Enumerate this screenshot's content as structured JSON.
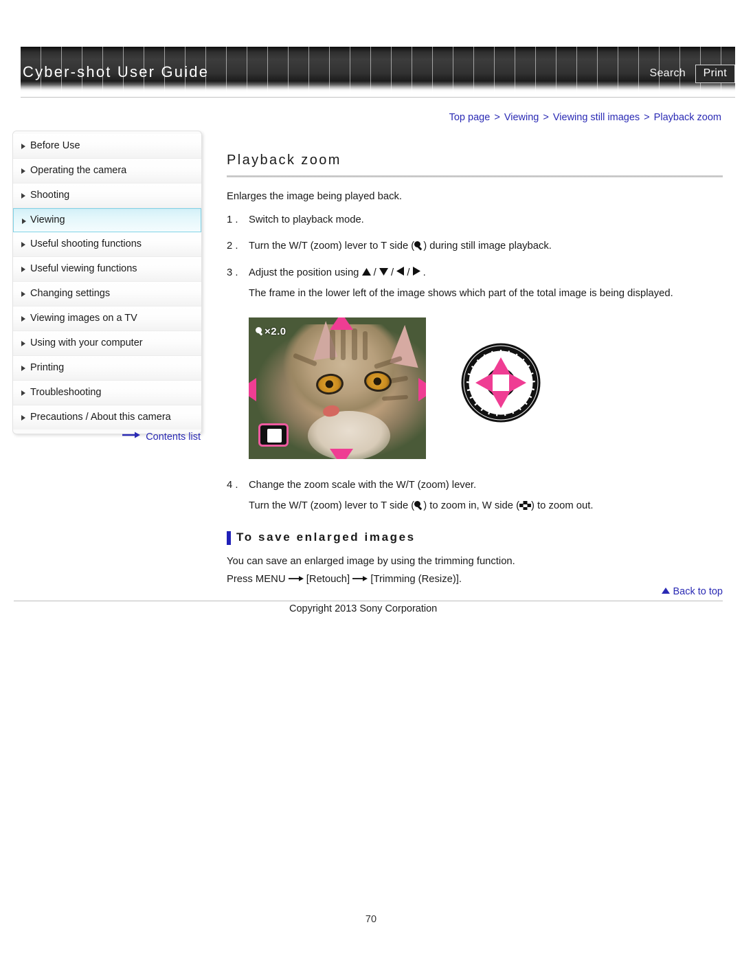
{
  "header": {
    "title": "Cyber-shot User Guide",
    "search_label": "Search",
    "print_label": "Print"
  },
  "breadcrumb": {
    "separator": ">",
    "items": [
      "Top page",
      "Viewing",
      "Viewing still images",
      "Playback zoom"
    ]
  },
  "sidebar": {
    "items": [
      {
        "label": "Before Use",
        "active": false
      },
      {
        "label": "Operating the camera",
        "active": false
      },
      {
        "label": "Shooting",
        "active": false
      },
      {
        "label": "Viewing",
        "active": true
      },
      {
        "label": "Useful shooting functions",
        "active": false
      },
      {
        "label": "Useful viewing functions",
        "active": false
      },
      {
        "label": "Changing settings",
        "active": false
      },
      {
        "label": "Viewing images on a TV",
        "active": false
      },
      {
        "label": "Using with your computer",
        "active": false
      },
      {
        "label": "Printing",
        "active": false
      },
      {
        "label": "Troubleshooting",
        "active": false
      },
      {
        "label": "Precautions / About this camera",
        "active": false
      }
    ],
    "contents_link": "Contents list"
  },
  "main": {
    "title": "Playback zoom",
    "intro": "Enlarges the image being played back.",
    "steps": [
      {
        "num": "1 .",
        "text_before": "Switch to playback mode.",
        "icon": null,
        "text_after": "",
        "sub": ""
      },
      {
        "num": "2 .",
        "text_before": "Turn the W/T (zoom) lever to T side (",
        "icon": "magnifier-icon",
        "text_after": ") during still image playback.",
        "sub": ""
      },
      {
        "num": "3 .",
        "text_before": "Adjust the position using ",
        "icon": "dpad-glyphs",
        "text_after": " .",
        "sub": "The frame in the lower left of the image shows which part of the total image is being displayed."
      },
      {
        "num": "4 .",
        "text_before": "Change the zoom scale with the W/T (zoom) lever.",
        "icon": null,
        "text_after": "",
        "sub": ""
      }
    ],
    "step4_sub_part1": "Turn the W/T (zoom) lever to T side (",
    "step4_sub_part2": ") to zoom in, W side (",
    "step4_sub_part3": ") to zoom out.",
    "figure": {
      "zoom_scale_label": "×2.0",
      "magnifier_icon": "magnifier-icon",
      "arrows": [
        "up-arrow-icon",
        "down-arrow-icon",
        "left-arrow-icon",
        "right-arrow-icon"
      ],
      "position_frame_icon": "position-frame-icon",
      "control_wheel_icon": "control-wheel-icon"
    },
    "subsection": {
      "title": "To save enlarged images",
      "line1": "You can save an enlarged image by using the trimming function.",
      "line2_part1": "Press MENU",
      "line2_part2": "[Retouch]",
      "line2_part3": "[Trimming (Resize)].",
      "arrow_glyph": "→"
    }
  },
  "footer": {
    "back_to_top": "Back to top",
    "copyright": "Copyright 2013 Sony Corporation",
    "page_number": "70"
  },
  "colors": {
    "link": "#2a2ab4",
    "accent_pink": "#ef3d93",
    "subhead_bar": "#2020b8",
    "active_nav_border": "#7fd2e6"
  }
}
